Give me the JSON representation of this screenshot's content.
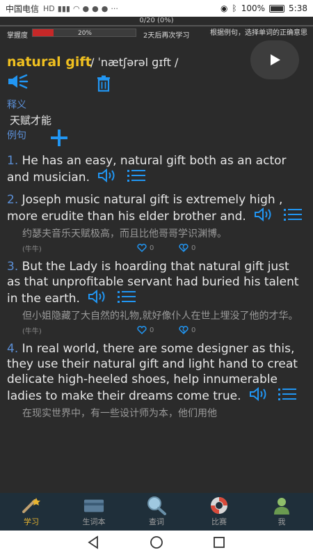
{
  "status_bar": {
    "carrier": "中国电信",
    "battery": "100%",
    "time": "5:38"
  },
  "progress": {
    "count": "0/20 (0%)",
    "mastery_label": "掌握度",
    "mastery_percent": "20%",
    "mastery_fraction": 0.2,
    "next_review": "2天后再次学习",
    "instruction": "根据例句，选择单词的正确意思"
  },
  "word": {
    "text": "natural gift",
    "phonetic": "/ ˈnætʃərəl ɡɪft /"
  },
  "definition": {
    "label": "释义",
    "text": "天赋才能"
  },
  "examples_label": "例句",
  "examples": [
    {
      "num": "1.",
      "en": "He has an easy, natural gift both as an actor and musician.",
      "cn": "",
      "source": "",
      "likes": "",
      "dislikes": ""
    },
    {
      "num": "2.",
      "en": "Joseph music natural gift is extremely high , more erudite than his elder brother and.",
      "cn": "约瑟夫音乐天赋极高，而且比他哥哥学识渊博。",
      "source": "(牛牛)",
      "likes": "0",
      "dislikes": "0"
    },
    {
      "num": "3.",
      "en": "But the Lady is hoarding that natural gift just as that unprofitable servant had buried his talent in the earth.",
      "cn": "但小姐隐藏了大自然的礼物,就好像仆人在世上埋没了他的才华。",
      "source": "(牛牛)",
      "likes": "0",
      "dislikes": "0"
    },
    {
      "num": "4.",
      "en": "In real world, there are some designer as this, they use their natural gift and light hand to creat delicate high-heeled shoes, help innumerable ladies to make their dreams come true.",
      "cn": "在现实世界中，有一些设计师为本，他们用他",
      "source": "",
      "likes": "",
      "dislikes": ""
    }
  ],
  "nav": [
    {
      "label": "学习",
      "icon": "wand-icon"
    },
    {
      "label": "生词本",
      "icon": "card-icon"
    },
    {
      "label": "查词",
      "icon": "magnifier-icon"
    },
    {
      "label": "比赛",
      "icon": "lifebuoy-icon"
    },
    {
      "label": "我",
      "icon": "person-icon"
    }
  ],
  "colors": {
    "word": "#f0c020",
    "accent_blue": "#5b8fd6",
    "icon_blue": "#2196f3",
    "active_nav": "#e8b530"
  }
}
